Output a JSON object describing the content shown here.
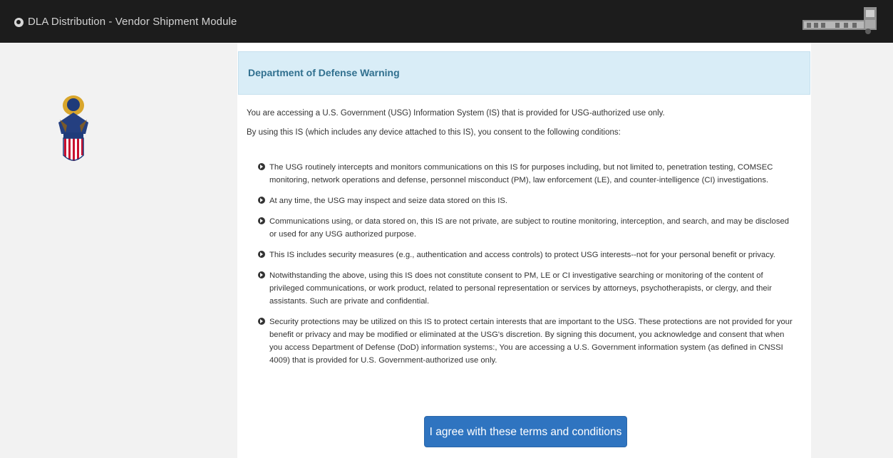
{
  "header": {
    "title": "DLA Distribution - Vendor Shipment Module",
    "globe_icon": "globe-icon",
    "right_logo": "truck-logo",
    "colors": {
      "background": "#1c1c1c",
      "text": "#d2d2d2"
    }
  },
  "sidebar": {
    "seal": "dla-eagle-seal"
  },
  "warning": {
    "heading": "Department of Defense Warning",
    "intro_1": "You are accessing a U.S. Government (USG) Information System (IS) that is provided for USG-authorized use only.",
    "intro_2": "By using this IS (which includes any device attached to this IS), you consent to the following conditions:",
    "items": [
      {
        "text": "The USG routinely intercepts and monitors communications on this IS for purposes including, but not limited to, penetration testing, COMSEC monitoring, network operations and defense, personnel misconduct (PM), law enforcement (LE), and counter-intelligence (CI) investigations."
      },
      {
        "text": "At any time, the USG may inspect and seize data stored on this IS."
      },
      {
        "text": "Communications using, or data stored on, this IS are not private, are subject to routine monitoring, interception, and search, and may be disclosed or used for any USG authorized purpose."
      },
      {
        "text": "This IS includes security measures (e.g., authentication and access controls) to protect USG interests--not for your personal benefit or privacy."
      },
      {
        "text": "Notwithstanding the above, using this IS does not constitute consent to PM, LE or CI investigative searching or monitoring of the content of privileged communications, or work product, related to personal representation or services by attorneys, psychotherapists, or clergy, and their assistants. Such are private and confidential."
      },
      {
        "text": "Security protections may be utilized on this IS to protect certain interests that are important to the USG. These protections are not provided for your benefit or privacy and may be modified or eliminated at the USG's discretion. By signing this document, you acknowledge and consent that when you access Department of Defense (DoD) information systems:, You are accessing a U.S. Government information system (as defined in CNSSI 4009) that is provided for U.S. Government-authorized use only."
      }
    ],
    "bullet_icon": "circle-chevron-right-icon",
    "colors": {
      "heading_bg": "#d9edf7",
      "heading_text": "#31708f"
    }
  },
  "actions": {
    "agree_label": "I agree with these terms and conditions",
    "agree_color": "#2f74c0"
  }
}
